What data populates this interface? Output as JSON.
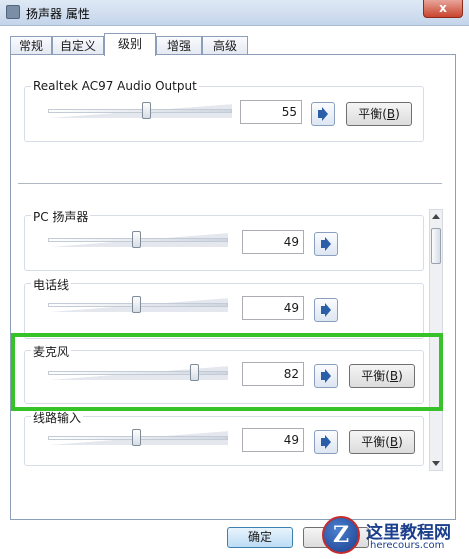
{
  "window": {
    "title": "扬声器 属性",
    "close_glyph": "x"
  },
  "tabs": [
    {
      "label": "常规",
      "active": false
    },
    {
      "label": "自定义",
      "active": false
    },
    {
      "label": "级别",
      "active": true
    },
    {
      "label": "增强",
      "active": false
    },
    {
      "label": "高级",
      "active": false
    }
  ],
  "devices": [
    {
      "label": "Realtek AC97 Audio Output",
      "value": "55",
      "balance_label": "平衡",
      "balance_key": "B"
    },
    {
      "label": "PC 扬声器",
      "value": "49"
    },
    {
      "label": "电话线",
      "value": "49"
    },
    {
      "label": "麦克风",
      "value": "82",
      "balance_label": "平衡",
      "balance_key": "B",
      "highlighted": true,
      "highlight_color": "#38c22a"
    },
    {
      "label": "线路输入",
      "value": "49",
      "balance_label": "平衡",
      "balance_key": "B"
    }
  ],
  "footer": {
    "ok_label": "确定"
  },
  "watermark": {
    "title": "这里教程网",
    "url": "herecours.com",
    "logo_letter": "Z"
  },
  "icons": {
    "speaker": "speaker-icon",
    "app": "speaker-app-icon"
  }
}
